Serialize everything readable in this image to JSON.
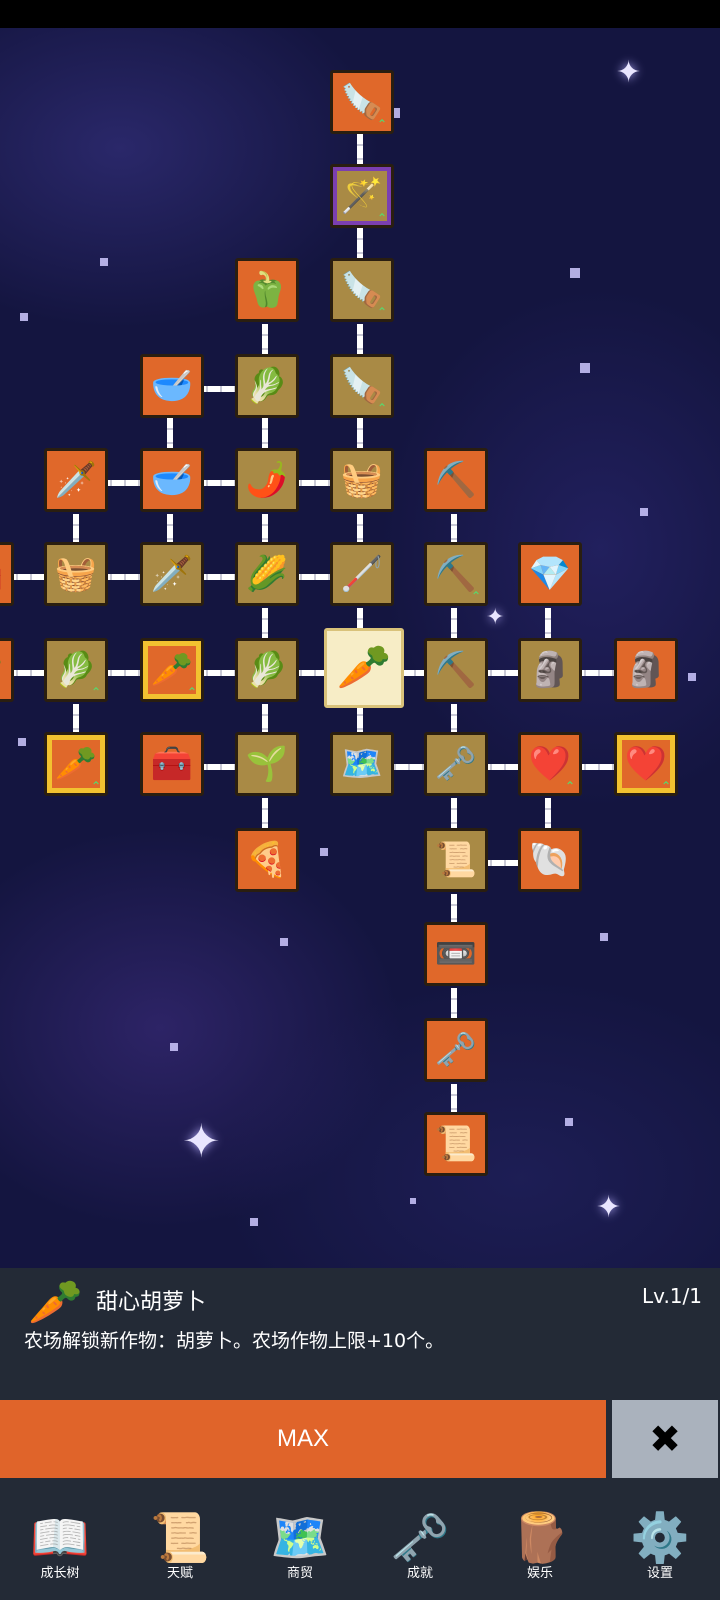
{
  "tree": {
    "nodes": [
      {
        "icon": "🪚",
        "name": "shovel-upgrade-3",
        "style": "orange",
        "up": true
      },
      {
        "icon": "🪄",
        "name": "shovel-magic",
        "style": "purple",
        "up": true
      },
      {
        "icon": "🫑",
        "name": "green-pepper",
        "style": "orange",
        "up": false
      },
      {
        "icon": "🪚",
        "name": "shovel-upgrade-2",
        "style": "gold",
        "up": true
      },
      {
        "icon": "🥣",
        "name": "bowl-1",
        "style": "orange",
        "up": false
      },
      {
        "icon": "🥬",
        "name": "white-radish",
        "style": "gold",
        "up": false
      },
      {
        "icon": "🪚",
        "name": "shovel-upgrade-1",
        "style": "gold",
        "up": true
      },
      {
        "icon": "🗡️",
        "name": "golden-sword",
        "style": "orange",
        "up": false
      },
      {
        "icon": "🥣",
        "name": "bowl-2",
        "style": "orange",
        "up": false
      },
      {
        "icon": "🌶️",
        "name": "chili-pepper",
        "style": "gold",
        "up": false
      },
      {
        "icon": "🧺",
        "name": "basket",
        "style": "gold",
        "up": false
      },
      {
        "icon": "⛏️",
        "name": "pickaxe-golden",
        "style": "orange",
        "up": false
      },
      {
        "icon": "🧰",
        "name": "edge-node-left-1",
        "style": "orange",
        "up": false
      },
      {
        "icon": "🧺",
        "name": "crate",
        "style": "gold",
        "up": false
      },
      {
        "icon": "🗡️",
        "name": "sword",
        "style": "gold",
        "up": false
      },
      {
        "icon": "🌽",
        "name": "corn",
        "style": "gold",
        "up": false
      },
      {
        "icon": "🦯",
        "name": "torch",
        "style": "gold",
        "up": false
      },
      {
        "icon": "⛏️",
        "name": "pickaxe-upgrade",
        "style": "gold",
        "up": true
      },
      {
        "icon": "💎",
        "name": "crystal",
        "style": "orange",
        "up": false
      },
      {
        "icon": "🥕",
        "name": "edge-node-left-2",
        "style": "orange",
        "up": false
      },
      {
        "icon": "🥬",
        "name": "cabbage-upgrade",
        "style": "gold",
        "up": true
      },
      {
        "icon": "🥕",
        "name": "carrot-upgrade",
        "style": "orange",
        "up": true
      },
      {
        "icon": "🥬",
        "name": "cabbage",
        "style": "gold",
        "up": false
      },
      {
        "icon": "🥕",
        "name": "sweet-carrot",
        "style": "glow",
        "up": false
      },
      {
        "icon": "⛏️",
        "name": "pickaxe",
        "style": "gold",
        "up": false
      },
      {
        "icon": "🗿",
        "name": "statue",
        "style": "gold",
        "up": false
      },
      {
        "icon": "🗿",
        "name": "statue-upgrade",
        "style": "orange",
        "up": false
      },
      {
        "icon": "🥕",
        "name": "carrot-golden-upgrade",
        "style": "orange",
        "up": true
      },
      {
        "icon": "🧰",
        "name": "treasure-chest",
        "style": "orange",
        "up": false
      },
      {
        "icon": "🌱",
        "name": "leek",
        "style": "gold",
        "up": false
      },
      {
        "icon": "🗺️",
        "name": "map",
        "style": "gold",
        "up": false
      },
      {
        "icon": "🗝️",
        "name": "golden-key",
        "style": "gold",
        "up": false
      },
      {
        "icon": "❤️",
        "name": "heart-upgrade",
        "style": "orange",
        "up": true
      },
      {
        "icon": "❤️",
        "name": "heart-golden-upgrade",
        "style": "orange",
        "up": true
      },
      {
        "icon": "🍕",
        "name": "pizza",
        "style": "orange",
        "up": false
      },
      {
        "icon": "📜",
        "name": "scroll-bundle",
        "style": "gold",
        "up": false
      },
      {
        "icon": "🐚",
        "name": "fossil-stone",
        "style": "orange",
        "up": false
      },
      {
        "icon": "📼",
        "name": "cassette",
        "style": "orange",
        "up": false
      },
      {
        "icon": "🗝️",
        "name": "key",
        "style": "orange",
        "up": false
      },
      {
        "icon": "📜",
        "name": "scroll",
        "style": "orange",
        "up": false
      }
    ]
  },
  "detail": {
    "icon": "🥕",
    "title": "甜心胡萝卜",
    "level": "Lv.1/1",
    "description": "农场解锁新作物：胡萝卜。农场作物上限+10个。"
  },
  "actions": {
    "max_label": "MAX",
    "close_icon": "✖"
  },
  "nav": [
    {
      "icon": "📖",
      "label": "成长树",
      "name": "nav-growth-tree"
    },
    {
      "icon": "📜",
      "label": "天赋",
      "name": "nav-talent"
    },
    {
      "icon": "🗺️",
      "label": "商贸",
      "name": "nav-trade"
    },
    {
      "icon": "🗝️",
      "label": "成就",
      "name": "nav-achievement"
    },
    {
      "icon": "🪵",
      "label": "娱乐",
      "name": "nav-entertainment"
    },
    {
      "icon": "⚙️",
      "label": "设置",
      "name": "nav-settings"
    }
  ]
}
